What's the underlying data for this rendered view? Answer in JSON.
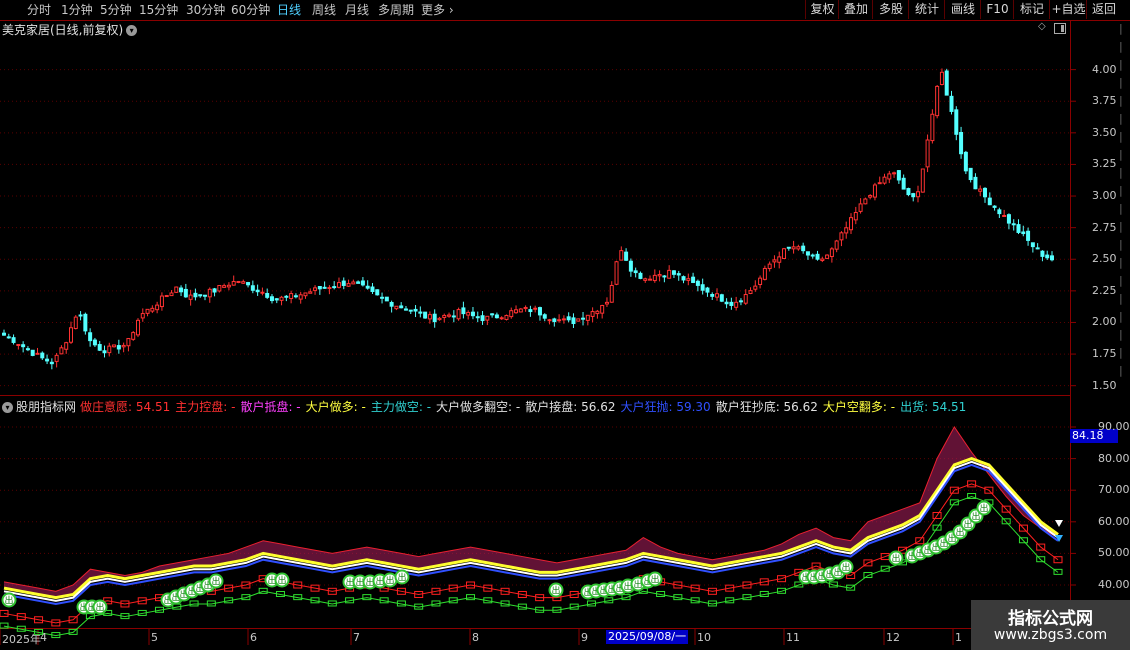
{
  "toolbar": {
    "periods": [
      "分时",
      "1分钟",
      "5分钟",
      "15分钟",
      "30分钟",
      "60分钟",
      "日线",
      "周线",
      "月线",
      "多周期",
      "更多"
    ],
    "active_period": "日线",
    "right_buttons": [
      "复权",
      "叠加",
      "多股",
      "统计",
      "画线",
      "F10",
      "标记",
      "+自选",
      "返回"
    ]
  },
  "stock": {
    "title": "美克家居(日线,前复权)"
  },
  "indicator": {
    "name": "股朋指标网",
    "items": [
      {
        "label": "做庄意愿:",
        "value": "54.51",
        "color": "#ff3030"
      },
      {
        "label": "主力控盘:",
        "value": "-",
        "color": "#ff3030"
      },
      {
        "label": "散户抵盘:",
        "value": "-",
        "color": "#ff40ff"
      },
      {
        "label": "大户做多:",
        "value": "-",
        "color": "#ffff40"
      },
      {
        "label": "主力做空:",
        "value": "-",
        "color": "#30d0d0"
      },
      {
        "label": "大户做多翻空:",
        "value": "-",
        "color": "#e0e0e0"
      },
      {
        "label": "散户接盘:",
        "value": "56.62",
        "color": "#e0e0e0"
      },
      {
        "label": "大户狂抛:",
        "value": "59.30",
        "color": "#3050ff"
      },
      {
        "label": "散户狂抄底:",
        "value": "56.62",
        "color": "#e0e0e0"
      },
      {
        "label": "大户空翻多:",
        "value": "-",
        "color": "#ffff40"
      },
      {
        "label": "出货:",
        "value": "54.51",
        "color": "#30d0d0"
      }
    ],
    "current_value": "84.18"
  },
  "price_axis": [
    "4.00",
    "3.75",
    "3.50",
    "3.25",
    "3.00",
    "2.75",
    "2.50",
    "2.25",
    "2.00",
    "1.75",
    "1.50"
  ],
  "ind_axis": [
    "90.00",
    "80.00",
    "70.00",
    "60.00",
    "50.00",
    "40.00"
  ],
  "x_axis": {
    "labels": [
      "2025年",
      "4",
      "5",
      "6",
      "7",
      "8",
      "9",
      "10",
      "11",
      "12",
      "1"
    ],
    "cursor_date": "2025/09/08/一"
  },
  "badge_text": "出",
  "watermark": {
    "title": "指标公式网",
    "url": "www.zbgs3.com"
  },
  "colors": {
    "up": "#ff3232",
    "down": "#54ffff",
    "grid": "#5a0000",
    "axis": "#8a0000"
  },
  "chart_data": {
    "type": "candlestick",
    "title": "美克家居(日线,前复权)",
    "ylim": [
      1.45,
      4.25
    ],
    "x_months": [
      "4",
      "5",
      "6",
      "7",
      "8",
      "9",
      "10",
      "11",
      "12",
      "1"
    ],
    "close_path": [
      1.9,
      1.85,
      1.78,
      1.72,
      1.68,
      1.85,
      2.1,
      1.85,
      1.78,
      1.8,
      1.83,
      2.05,
      2.12,
      2.2,
      2.28,
      2.2,
      2.22,
      2.25,
      2.3,
      2.33,
      2.28,
      2.24,
      2.18,
      2.2,
      2.22,
      2.25,
      2.28,
      2.3,
      2.32,
      2.28,
      2.22,
      2.17,
      2.13,
      2.1,
      2.05,
      2.03,
      2.06,
      2.08,
      2.05,
      2.03,
      2.05,
      2.08,
      2.1,
      2.1,
      2.05,
      2.02,
      2.0,
      2.05,
      2.1,
      2.18,
      2.6,
      2.4,
      2.35,
      2.38,
      2.4,
      2.35,
      2.3,
      2.25,
      2.2,
      2.15,
      2.2,
      2.3,
      2.45,
      2.55,
      2.6,
      2.55,
      2.48,
      2.55,
      2.7,
      2.85,
      3.0,
      3.1,
      3.2,
      3.05,
      2.95,
      3.5,
      4.0,
      3.6,
      3.2,
      3.05,
      2.95,
      2.85,
      2.75,
      2.65,
      2.55,
      2.5
    ],
    "indicator_lines": {
      "做庄意愿": [
        41,
        40,
        39,
        38,
        40,
        45,
        44,
        43,
        44,
        46,
        47,
        48,
        49,
        50,
        52,
        54,
        53,
        52,
        51,
        50,
        51,
        52,
        51,
        50,
        49,
        50,
        51,
        52,
        51,
        50,
        49,
        48,
        47,
        48,
        49,
        50,
        51,
        55,
        52,
        50,
        49,
        48,
        49,
        50,
        51,
        53,
        56,
        58,
        55,
        54,
        60,
        62,
        64,
        66,
        80,
        90,
        82,
        75,
        68,
        62,
        58,
        55
      ],
      "大户狂抛": [
        39,
        38,
        37,
        36,
        37,
        42,
        43,
        42,
        43,
        44,
        45,
        46,
        46,
        47,
        48,
        50,
        49,
        48,
        47,
        46,
        47,
        48,
        47,
        46,
        45,
        46,
        47,
        48,
        47,
        46,
        45,
        44,
        44,
        45,
        46,
        47,
        48,
        50,
        49,
        48,
        47,
        46,
        47,
        48,
        49,
        50,
        52,
        54,
        52,
        51,
        55,
        57,
        59,
        62,
        70,
        78,
        80,
        78,
        72,
        66,
        60,
        56
      ]
    }
  }
}
